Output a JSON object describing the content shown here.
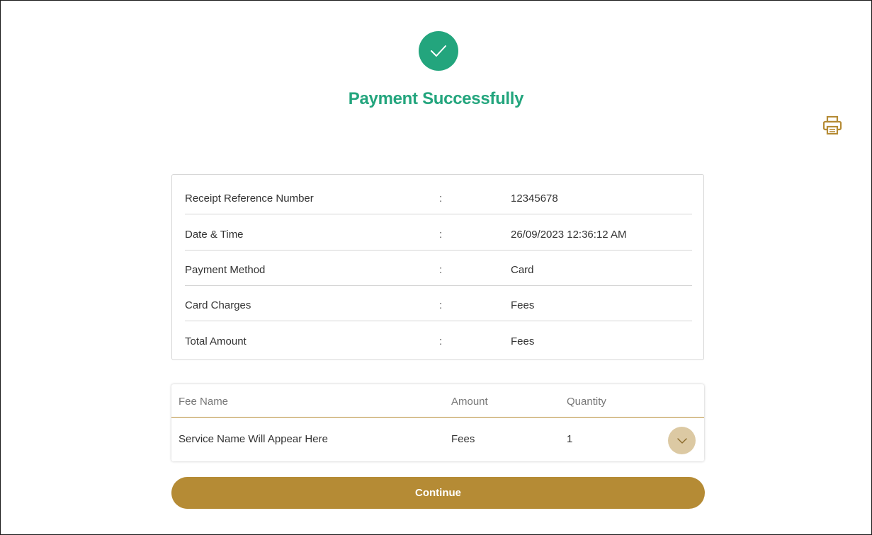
{
  "status": {
    "icon": "check-circle-icon",
    "title": "Payment Successfully",
    "color": "#23a57d"
  },
  "toolbar": {
    "print_icon": "printer-icon",
    "icon_color": "#b58b35"
  },
  "receipt": {
    "separator": ":",
    "rows": [
      {
        "label": "Receipt Reference Number",
        "value": "12345678"
      },
      {
        "label": "Date & Time",
        "value": "26/09/2023 12:36:12 AM"
      },
      {
        "label": "Payment Method",
        "value": "Card"
      },
      {
        "label": "Card Charges",
        "value": "Fees"
      },
      {
        "label": "Total Amount",
        "value": "Fees"
      }
    ]
  },
  "fees": {
    "headers": {
      "name": "Fee Name",
      "amount": "Amount",
      "quantity": "Quantity"
    },
    "rows": [
      {
        "name": "Service Name Will Appear Here",
        "amount": "Fees",
        "quantity": "1",
        "expand_icon": "chevron-down-icon"
      }
    ]
  },
  "actions": {
    "continue_label": "Continue",
    "accent_color": "#b58b35"
  }
}
